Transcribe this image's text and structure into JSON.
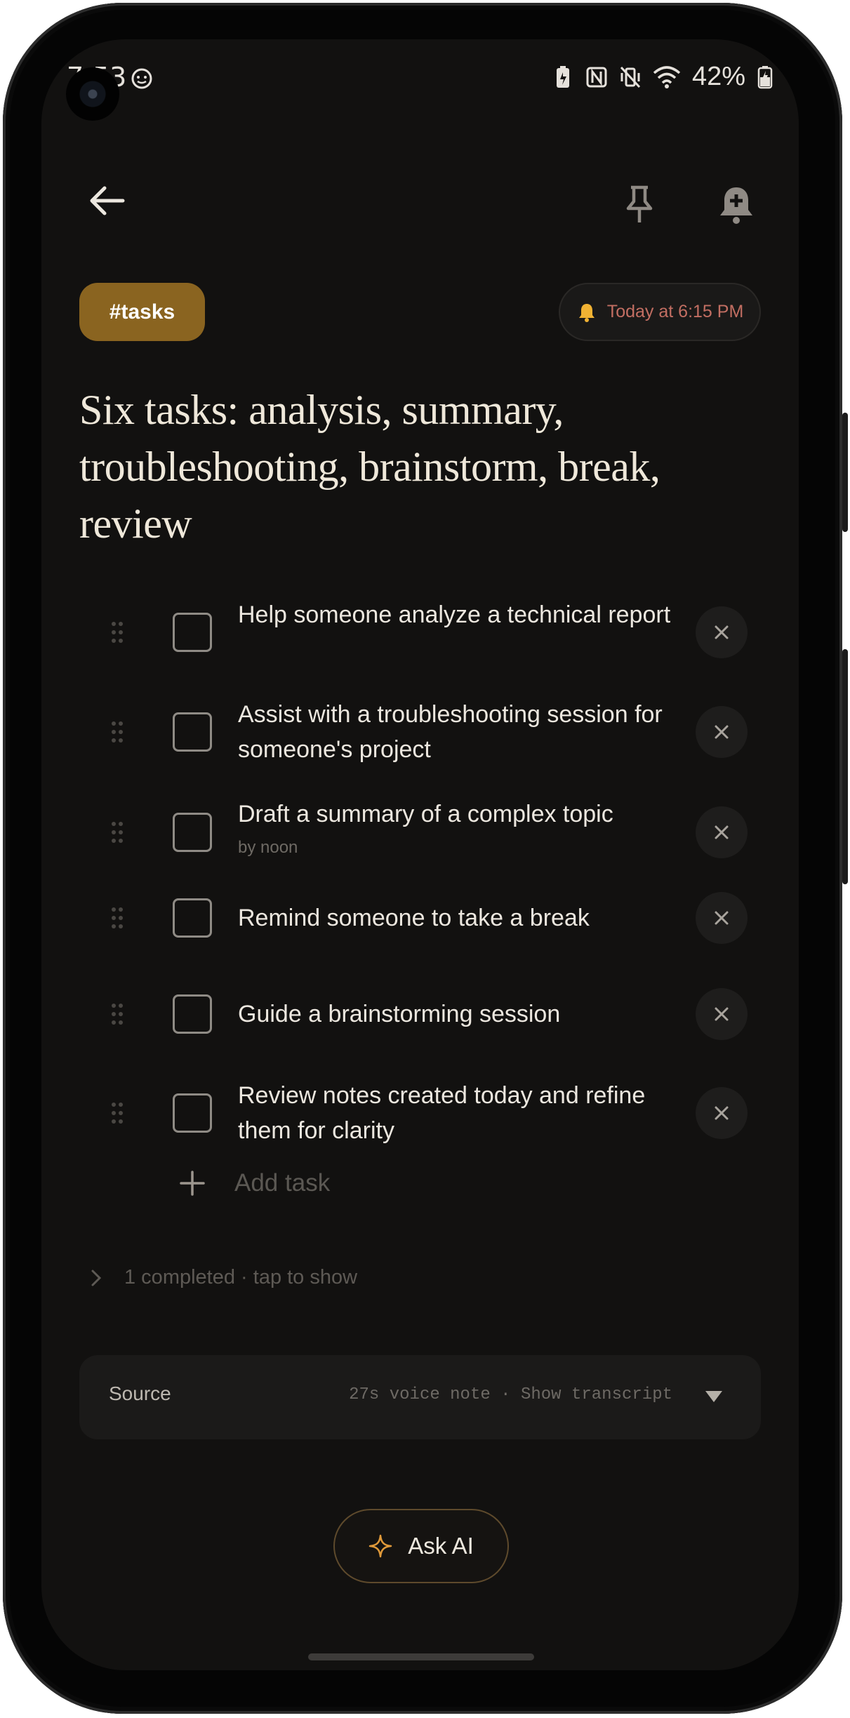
{
  "status_bar": {
    "time": "7:53",
    "battery": "42%"
  },
  "header": {
    "back_icon": "arrow-left-icon",
    "pin_icon": "pin-icon",
    "reminder_icon": "alarm-add-icon"
  },
  "tag": "#tasks",
  "reminder": {
    "label": "Today at 6:15 PM",
    "icon": "bell-icon"
  },
  "title": "Six tasks: analysis, summary, troubleshooting, brainstorm, break, review",
  "tasks": [
    {
      "text": "Help someone analyze a technical report",
      "sub": "",
      "checked": false
    },
    {
      "text": "Assist with a troubleshooting session for someone's project",
      "sub": "",
      "checked": false
    },
    {
      "text": "Draft a summary of a complex topic",
      "sub": "by noon",
      "checked": false
    },
    {
      "text": "Remind someone to take a break",
      "sub": "",
      "checked": false
    },
    {
      "text": "Guide a brainstorming session",
      "sub": "",
      "checked": false
    },
    {
      "text": "Review notes created today and refine them for clarity",
      "sub": "",
      "checked": false
    }
  ],
  "add_task": "Add task",
  "completed": "1 completed · tap to show",
  "source": {
    "label": "Source",
    "meta": "27s voice note · Show transcript"
  },
  "ask_ai": "Ask AI",
  "colors": {
    "accent": "#8a6420",
    "reminder_text": "#c26e62",
    "background": "#121110"
  }
}
